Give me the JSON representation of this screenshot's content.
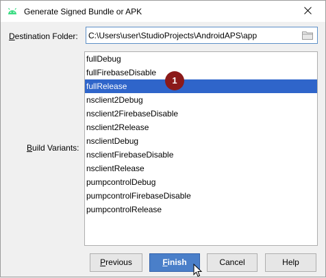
{
  "window": {
    "title": "Generate Signed Bundle or APK",
    "icon": "android-icon",
    "close_icon": "close-icon"
  },
  "destination": {
    "label_underlined": "D",
    "label_rest": "estination Folder:",
    "value": "C:\\Users\\user\\StudioProjects\\AndroidAPS\\app",
    "browse_icon": "folder-icon"
  },
  "build_variants": {
    "label_underlined": "B",
    "label_rest": "uild Variants:",
    "selected": "fullRelease",
    "items": [
      "fullDebug",
      "fullFirebaseDisable",
      "fullRelease",
      "nsclient2Debug",
      "nsclient2FirebaseDisable",
      "nsclient2Release",
      "nsclientDebug",
      "nsclientFirebaseDisable",
      "nsclientRelease",
      "pumpcontrolDebug",
      "pumpcontrolFirebaseDisable",
      "pumpcontrolRelease"
    ]
  },
  "annotation": {
    "badge": "1"
  },
  "buttons": {
    "previous_underlined": "P",
    "previous_rest": "revious",
    "finish_underlined": "F",
    "finish_rest": "inish",
    "cancel": "Cancel",
    "help": "Help"
  },
  "colors": {
    "selection": "#2f65ca",
    "accent_button": "#4a7fc9",
    "badge": "#8b1a1a"
  }
}
